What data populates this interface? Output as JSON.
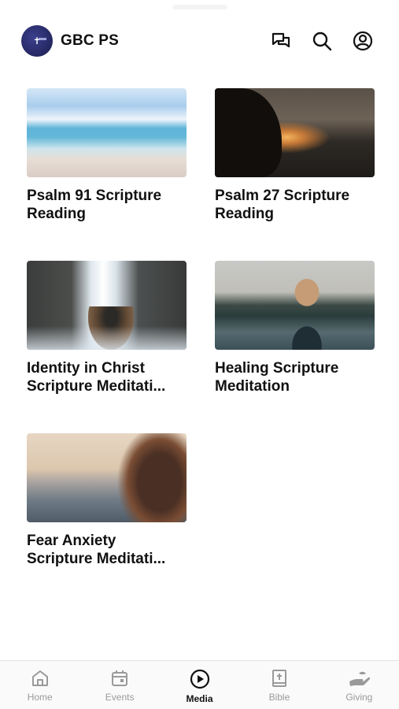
{
  "header": {
    "app_title": "GBC PS",
    "logo_icon": "church-logo-icon",
    "icons": [
      "chat-icon",
      "search-icon",
      "account-icon"
    ]
  },
  "media_items": [
    {
      "title": "Psalm 91 Scripture\nReading",
      "thumb": "beach"
    },
    {
      "title": "Psalm 27 Scripture\nReading",
      "thumb": "sunset"
    },
    {
      "title": "Identity in Christ\nScripture Meditati...",
      "thumb": "waterfall"
    },
    {
      "title": "Healing Scripture\nMeditation",
      "thumb": "lake"
    },
    {
      "title": "Fear Anxiety\nScripture Meditati...",
      "thumb": "hair"
    }
  ],
  "tabbar": {
    "active": "Media",
    "items": [
      {
        "label": "Home",
        "icon": "home-icon"
      },
      {
        "label": "Events",
        "icon": "calendar-icon"
      },
      {
        "label": "Media",
        "icon": "play-circle-icon"
      },
      {
        "label": "Bible",
        "icon": "bible-icon"
      },
      {
        "label": "Giving",
        "icon": "giving-hand-icon"
      }
    ]
  },
  "colors": {
    "accent": "#111111",
    "inactive": "#9a9a9a",
    "logo_bg": "#24275f"
  }
}
